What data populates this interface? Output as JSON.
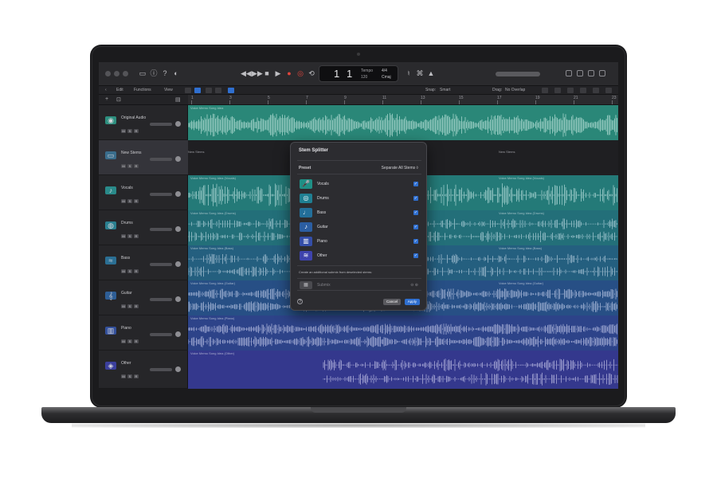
{
  "transport": {
    "lcd": {
      "bar": "1",
      "beat": "1",
      "key_top": "Tempo",
      "key_bottom": "120",
      "sig_top": "4/4",
      "sig_bottom": "Cmaj"
    }
  },
  "toolbar": {
    "menus": [
      "Edit",
      "Functions",
      "View"
    ],
    "snap_label": "Snap:",
    "snap_value": "Smart",
    "drag_label": "Drag:",
    "drag_value": "No Overlap"
  },
  "ruler": {
    "bars": [
      "1",
      "3",
      "5",
      "7",
      "9",
      "11",
      "13",
      "15",
      "17",
      "19",
      "21",
      "23"
    ]
  },
  "tracks": [
    {
      "name": "Original Audio",
      "color": "#2d8f7f"
    },
    {
      "name": "New Stems",
      "color": "#3a6d8c"
    },
    {
      "name": "Vocals",
      "color": "#2a8a8a"
    },
    {
      "name": "Drums",
      "color": "#2a7f8f"
    },
    {
      "name": "Bass",
      "color": "#2b6f94"
    },
    {
      "name": "Guitar",
      "color": "#2e5e96"
    },
    {
      "name": "Piano",
      "color": "#33509b"
    },
    {
      "name": "Other",
      "color": "#3b3f9c"
    }
  ],
  "regions": {
    "original": "Voice Memo Song Idea",
    "new_stems_left": "New Stems",
    "new_stems_right": "New Stems",
    "vocals": "Voice Memo Song Idea (Vocals)",
    "drums": "Voice Memo Song Idea (Drums)",
    "bass": "Voice Memo Song Idea (Bass)",
    "guitar": "Voice Memo Song Idea (Guitar)",
    "piano": "Voice Memo Song Idea (Piano)",
    "other": "Voice Memo Song Idea (Other)"
  },
  "msr": [
    "M",
    "S",
    "R"
  ],
  "dialog": {
    "title": "Stem Splitter",
    "preset_label": "Preset",
    "preset_value": "Separate All Stems ◊",
    "stems": [
      {
        "label": "Vocals",
        "icon": "microphone-icon",
        "color": "#1f8f85",
        "checked": true
      },
      {
        "label": "Drums",
        "icon": "drums-icon",
        "color": "#1f7f92",
        "checked": true
      },
      {
        "label": "Bass",
        "icon": "bass-guitar-icon",
        "color": "#236f9a",
        "checked": true
      },
      {
        "label": "Guitar",
        "icon": "guitar-icon",
        "color": "#2b5ea2",
        "checked": true
      },
      {
        "label": "Piano",
        "icon": "piano-icon",
        "color": "#344ea8",
        "checked": true
      },
      {
        "label": "Other",
        "icon": "waveform-icon",
        "color": "#3e43ad",
        "checked": true
      }
    ],
    "note": "Create an additional submix from deselected stems:",
    "submix_label": "Submix",
    "cancel_label": "Cancel",
    "apply_label": "Apply",
    "help_label": "?"
  }
}
